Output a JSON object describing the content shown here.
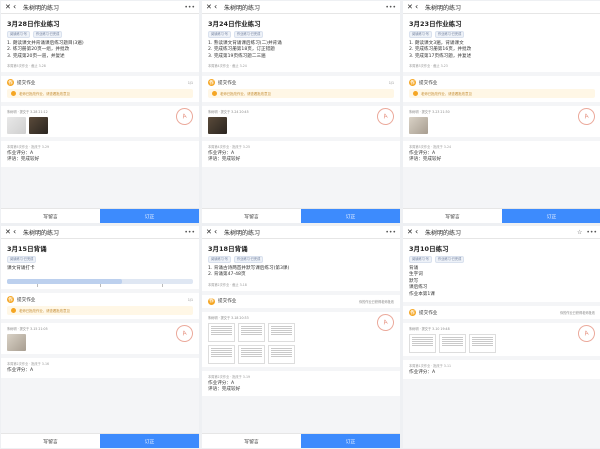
{
  "panels": [
    {
      "header": {
        "title": "朱树明的练习"
      },
      "homework": {
        "title": "3月28日作业练习",
        "tags": [
          "阅读练习·写",
          "作业练习·已完成"
        ],
        "lines": [
          "1. 朗读课文并背诵课后练习题目(3遍)",
          "2. 练习册第20页一组，并批改",
          "3. 完成第20页一道，并复述"
        ],
        "meta": "本周第5次作业 · 截止 3-28"
      },
      "section": {
        "title": "提交作业",
        "right": "1/1"
      },
      "notice": "老师已批改作业，请查看批改意见",
      "submission": {
        "meta": "朱树明 · 提交于 3-28 21:12"
      },
      "review": {
        "meta": "本周第5次作业 · 批改于 3-29",
        "line1": "作业评分：A",
        "line2": "评语：完成较好"
      },
      "buttons": {
        "left": "写留言",
        "right": "订正"
      }
    },
    {
      "header": {
        "title": "朱树明的练习"
      },
      "homework": {
        "title": "3月24日作业练习",
        "tags": [
          "阅读练习·写",
          "作业练习·已完成"
        ],
        "lines": [
          "1. 熟读课文背诵课后练习(二)并背诵",
          "2. 完成练习册第18页，订正错题",
          "3. 完成第19页练习题二三遍"
        ],
        "meta": "本周第4次作业 · 截止 3-24"
      },
      "section": {
        "title": "提交作业",
        "right": "1/1"
      },
      "notice": "老师已批改作业，请查看批改意见",
      "submission": {
        "meta": "朱树明 · 提交于 3-24 20:45"
      },
      "review": {
        "meta": "本周第4次作业 · 批改于 3-25",
        "line1": "作业评分：A",
        "line2": "评语：完成较好"
      },
      "buttons": {
        "left": "写留言",
        "right": "订正"
      }
    },
    {
      "header": {
        "title": "朱树明的练习"
      },
      "homework": {
        "title": "3月23日作业练习",
        "tags": [
          "阅读练习·写",
          "作业练习·已完成"
        ],
        "lines": [
          "1. 朗读课文3遍，背诵课文",
          "2. 完成练习册第16页，并批改",
          "3. 完成第17页练习题，并复述"
        ],
        "meta": "本周第3次作业 · 截止 3-23"
      },
      "section": {
        "title": "提交作业",
        "right": ""
      },
      "notice": "老师已批改作业，请查看批改意见",
      "submission": {
        "meta": "朱树明 · 提交于 3-23 21:30"
      },
      "review": {
        "meta": "本周第3次作业 · 批改于 3-24",
        "line1": "作业评分：A",
        "line2": "评语：完成较好"
      },
      "buttons": {
        "left": "写留言",
        "right": "订正"
      }
    },
    {
      "header": {
        "title": "朱树明的练习"
      },
      "homework": {
        "title": "3月15日背诵",
        "tags": [
          "阅读练习·已完成"
        ],
        "lines": [
          "课文背诵打卡"
        ],
        "meta": ""
      },
      "progress": {
        "fill": 0.62
      },
      "section": {
        "title": "提交作业",
        "right": "1/1"
      },
      "notice": "老师已批改作业，请查看批改意见",
      "submission": {
        "meta": "朱树明 · 提交于 3-15 21:05"
      },
      "review": {
        "meta": "本周第2次作业 · 批改于 3-16",
        "line1": "作业评分：A",
        "line2": ""
      },
      "buttons": {
        "left": "写留言",
        "right": "订正"
      }
    },
    {
      "header": {
        "title": "朱树明的练习"
      },
      "homework": {
        "title": "3月18日背诵",
        "tags": [
          "阅读练习·写",
          "作业练习·已完成"
        ],
        "lines": [
          "1. 背诵古诗两首并默写课后练习(第3课)",
          "2. 背诵第47-48页"
        ],
        "meta": "本周第2次作业 · 截止 3-18"
      },
      "section": {
        "title": "提交作业",
        "right": "你的作业已获得老师批改"
      },
      "notice": "",
      "submission": {
        "meta": "朱树明 · 提交于 3-18 20:33"
      },
      "review": {
        "meta": "本周第2次作业 · 批改于 3-19",
        "line1": "作业评分：A",
        "line2": "评语：完成较好"
      },
      "buttons": {
        "left": "写留言",
        "right": "订正"
      }
    },
    {
      "header": {
        "title": "朱树明的练习"
      },
      "homework": {
        "title": "3月10日练习",
        "tags": [
          "阅读练习·写",
          "作业练习·已完成"
        ],
        "lines": [
          "背诵",
          "生字词",
          "默写",
          "课后练习",
          "作业本第1课"
        ],
        "meta": ""
      },
      "section": {
        "title": "提交作业",
        "right": "你的作业已获得老师批改"
      },
      "notice": "",
      "submission": {
        "meta": "朱树明 · 提交于 3-10 19:48"
      },
      "review": {
        "meta": "本周第1次作业 · 批改于 3-11",
        "line1": "作业评分：A",
        "line2": ""
      },
      "buttons": {
        "left": "写留言",
        "right": "订正"
      }
    }
  ],
  "icons": {
    "close": "close-icon",
    "back": "back-arrow-icon",
    "more": "more-icon",
    "star": "star-icon"
  },
  "colors": {
    "accent": "#3d8bfd",
    "badge": "#f5a623",
    "notice_bg": "#fff7e6",
    "stamp": "#e07a65"
  }
}
